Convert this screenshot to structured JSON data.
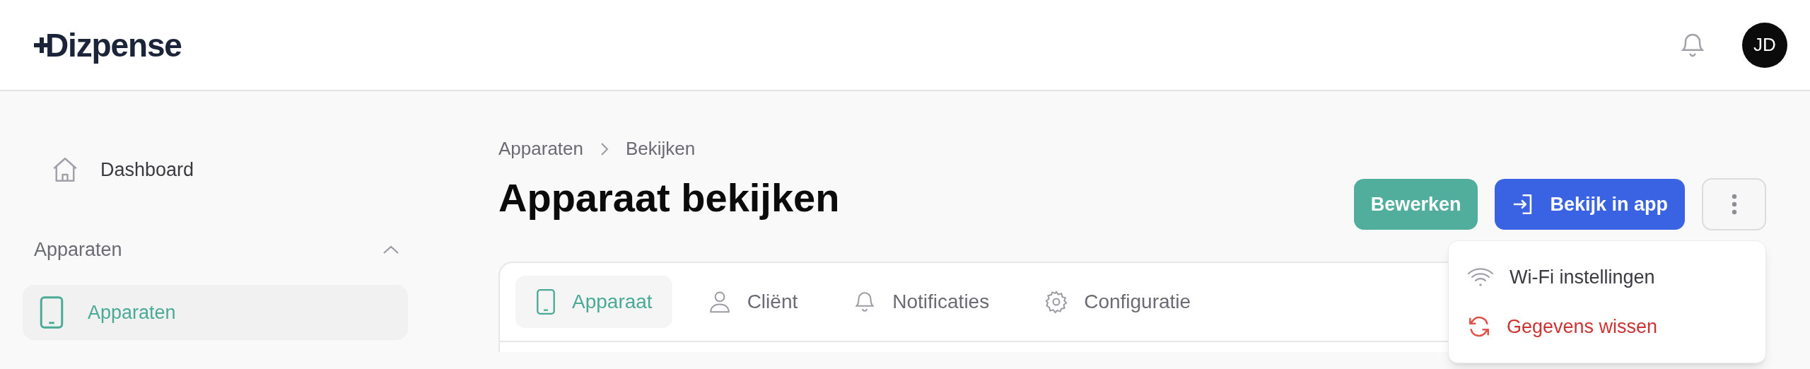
{
  "brand": "Dizpense",
  "header": {
    "avatar": "JD"
  },
  "sidebar": {
    "items": [
      {
        "label": "Dashboard",
        "selected": false
      }
    ],
    "sections": [
      {
        "title": "Apparaten",
        "expanded": true,
        "items": [
          {
            "label": "Apparaten",
            "selected": true
          }
        ]
      }
    ]
  },
  "breadcrumb": [
    "Apparaten",
    "Bekijken"
  ],
  "title": "Apparaat bekijken",
  "actions": [
    {
      "label": "Bewerken",
      "kind": "secondary"
    },
    {
      "label": "Bekijk in app",
      "kind": "primary"
    }
  ],
  "menu": {
    "items": [
      {
        "label": "Wi-Fi instellingen",
        "kind": "normal"
      },
      {
        "label": "Gegevens wissen",
        "kind": "danger"
      }
    ]
  },
  "tabs": [
    {
      "label": "Apparaat",
      "selected": true
    },
    {
      "label": "Cliënt",
      "selected": false
    },
    {
      "label": "Notificaties",
      "selected": false
    },
    {
      "label": "Configuratie",
      "selected": false
    }
  ]
}
